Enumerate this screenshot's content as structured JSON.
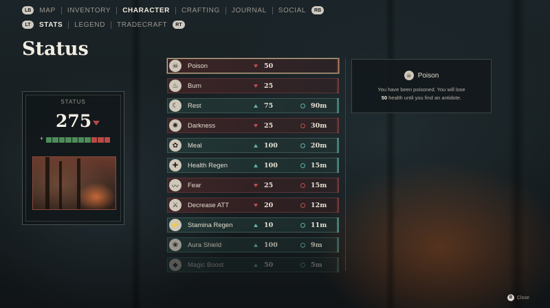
{
  "nav_top": {
    "left_button": "LB",
    "right_button": "RB",
    "items": [
      "MAP",
      "INVENTORY",
      "CHARACTER",
      "CRAFTING",
      "JOURNAL",
      "SOCIAL"
    ],
    "active": "CHARACTER"
  },
  "nav_sub": {
    "left_button": "LT",
    "right_button": "RT",
    "items": [
      "STATS",
      "LEGEND",
      "TRADECRAFT"
    ],
    "active": "STATS"
  },
  "page_title": "Status",
  "status_card": {
    "label": "STATUS",
    "value": "275",
    "trend": "down",
    "plus_symbol": "+",
    "health_bar": {
      "green_segments": 7,
      "red_segments": 3,
      "color_green": "#4e8b5a",
      "color_red": "#b84a48"
    }
  },
  "status_list": [
    {
      "name": "Poison",
      "icon": "skull-icon",
      "effect": "negative",
      "trend": "down",
      "value": "50",
      "time": "",
      "selected": true
    },
    {
      "name": "Burn",
      "icon": "flame-icon",
      "effect": "negative",
      "trend": "down",
      "value": "25",
      "time": ""
    },
    {
      "name": "Rest",
      "icon": "moon-icon",
      "effect": "positive",
      "trend": "up",
      "value": "75",
      "time": "90m"
    },
    {
      "name": "Darkness",
      "icon": "darkness-icon",
      "effect": "negative",
      "trend": "down",
      "value": "25",
      "time": "30m"
    },
    {
      "name": "Meal",
      "icon": "meal-icon",
      "effect": "positive",
      "trend": "up",
      "value": "100",
      "time": "20m"
    },
    {
      "name": "Health Regen",
      "icon": "regen-icon",
      "effect": "positive",
      "trend": "up",
      "value": "100",
      "time": "15m"
    },
    {
      "name": "Fear",
      "icon": "bat-icon",
      "effect": "negative",
      "trend": "down",
      "value": "25",
      "time": "15m"
    },
    {
      "name": "Decrease ATT",
      "icon": "sword-icon",
      "effect": "negative",
      "trend": "down",
      "value": "20",
      "time": "12m"
    },
    {
      "name": "Stamina Regen",
      "icon": "lightning-icon",
      "effect": "positive",
      "trend": "up",
      "value": "10",
      "time": "11m"
    },
    {
      "name": "Aura Shield",
      "icon": "lotus-icon",
      "effect": "positive",
      "trend": "up",
      "value": "100",
      "time": "9m"
    },
    {
      "name": "Magic Boost",
      "icon": "gem-icon",
      "effect": "positive",
      "trend": "up",
      "value": "50",
      "time": "5m"
    }
  ],
  "detail": {
    "name": "Poison",
    "icon": "skull-icon",
    "desc_line1": "You have been poisoned. You will lose",
    "desc_amount": "50",
    "desc_line2": " health until you find an antidote."
  },
  "close_hint": {
    "button": "B",
    "label": "Close"
  },
  "colors": {
    "negative": "#c0514e",
    "positive": "#62b6a6",
    "selected_border": "#c9b28a"
  }
}
